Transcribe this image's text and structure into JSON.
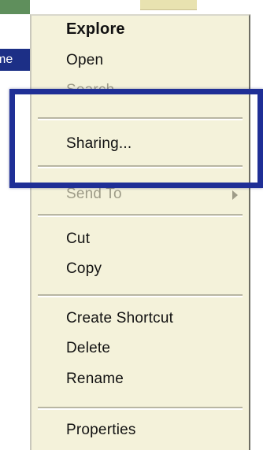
{
  "desktop": {
    "selected_label": "me"
  },
  "menu": {
    "explore": "Explore",
    "open": "Open",
    "search": "Search...",
    "sharing": "Sharing...",
    "send_to": "Send To",
    "cut": "Cut",
    "copy": "Copy",
    "create_shortcut": "Create Shortcut",
    "delete": "Delete",
    "rename": "Rename",
    "properties": "Properties"
  },
  "colors": {
    "menu_background": "#f4f2da",
    "highlight_border": "#1f2f96",
    "selection_background": "#1c2f86"
  }
}
